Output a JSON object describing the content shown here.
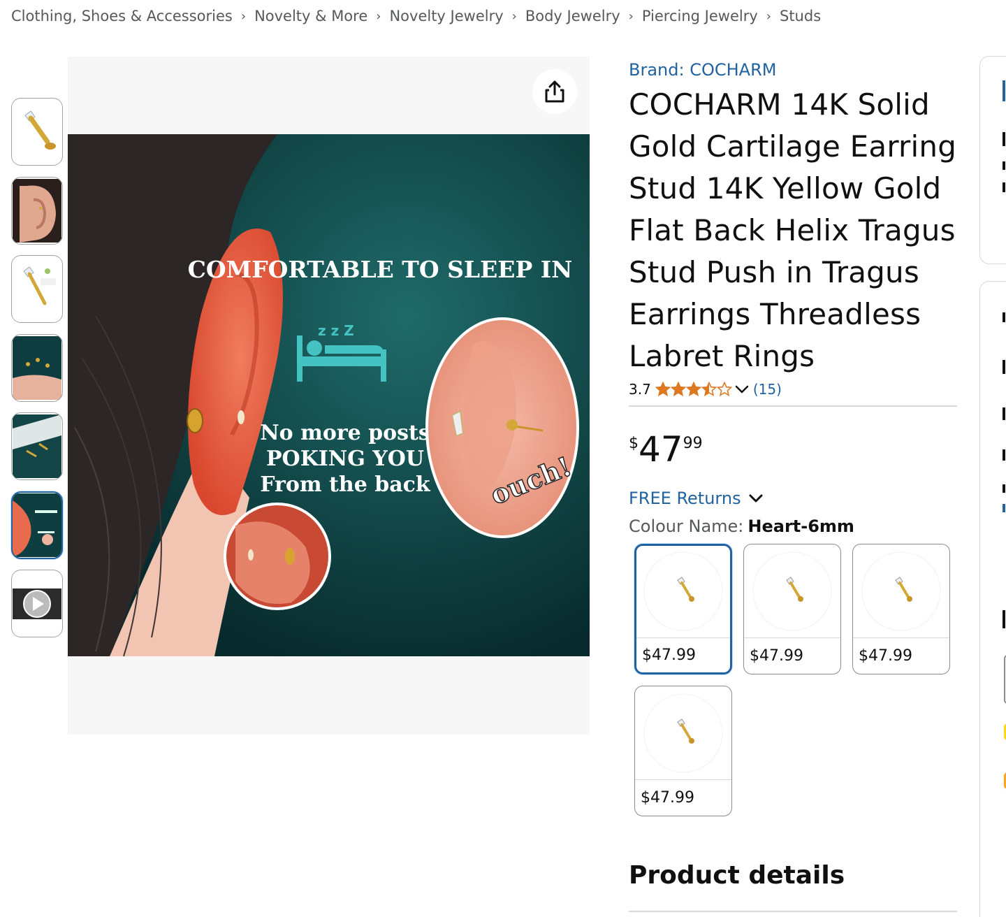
{
  "breadcrumb": [
    "Clothing, Shoes & Accessories",
    "Novelty & More",
    "Novelty Jewelry",
    "Body Jewelry",
    "Piercing Jewelry",
    "Studs"
  ],
  "breadcrumb_separator": "›",
  "thumbnails": [
    {
      "name": "thumbnail-stud-product"
    },
    {
      "name": "thumbnail-ear-photo"
    },
    {
      "name": "thumbnail-stud-size"
    },
    {
      "name": "thumbnail-hand-studs"
    },
    {
      "name": "thumbnail-studs-display"
    },
    {
      "name": "thumbnail-comfort-image",
      "selected": true
    },
    {
      "name": "thumbnail-video"
    }
  ],
  "main_image": {
    "headline": "COMFORTABLE TO SLEEP IN",
    "body_line_1": "No more posts",
    "body_line_2": "POKING YOU",
    "body_line_3": "From the back",
    "callout": "ouch!",
    "sleep_zzz": "z z Z"
  },
  "brand": "Brand: COCHARM",
  "title": "COCHARM 14K Solid Gold Cartilage Earring Stud 14K Yellow Gold Flat Back Helix Tragus Stud Push in Tragus Earrings Threadless Labret Rings",
  "rating": {
    "value": "3.7",
    "stars": 3.7,
    "count": "(15)"
  },
  "price": {
    "symbol": "$",
    "whole": "47",
    "fraction": "99"
  },
  "returns": "FREE Returns",
  "colour": {
    "label": "Colour Name:",
    "value": "Heart-6mm"
  },
  "swatches": [
    {
      "price": "$47.99",
      "selected": true
    },
    {
      "price": "$47.99",
      "selected": false
    },
    {
      "price": "$47.99",
      "selected": false
    },
    {
      "price": "$47.99",
      "selected": false
    }
  ],
  "product_details_heading": "Product details",
  "colors": {
    "link": "#2162a1",
    "star": "#de7921",
    "text": "#0f1111",
    "muted": "#565959",
    "border": "#d5d9d9",
    "selected": "#2162a1"
  }
}
